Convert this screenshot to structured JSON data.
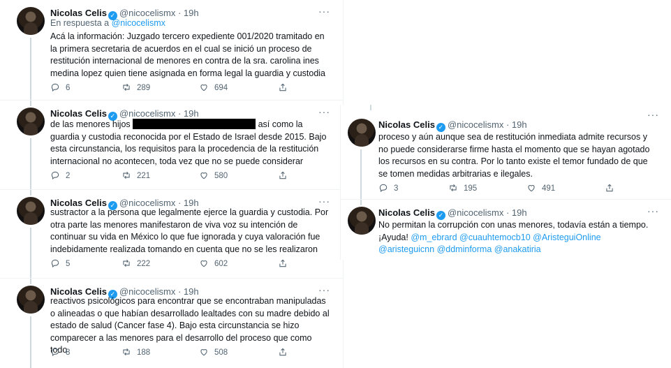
{
  "author": {
    "name": "Nicolas Celis",
    "handle": "@nicocelismx",
    "time": "19h",
    "dot": "·"
  },
  "left_tweets": [
    {
      "reply_prefix": "En respuesta a ",
      "reply_mention": "@nicocelismx",
      "text": "Acá la información: Juzgado tercero expediente 001/2020 tramitado en la primera secretaria de acuerdos en el cual se inició un proceso de restitución internacional de menores en contra de la sra. carolina ines medina lopez quien tiene asignada en forma legal la guardia y custodia",
      "replies": "6",
      "retweets": "289",
      "likes": "694"
    },
    {
      "text_before": "de las menores hijos ",
      "text_after": " así como la guardia y custodia reconocida por el Estado de Israel desde 2015. Bajo esta circunstancia, los requisitos para la procedencia de la restitución internacional no acontecen, toda vez que no se puede considerar",
      "replies": "2",
      "retweets": "221",
      "likes": "580"
    },
    {
      "text": "sustractor a la persona que legalmente ejerce la guardia y custodia. Por otra parte las menores manifestaron de viva voz su intención de continuar su vida en México lo que fue ignorada y cuya  valoración fue indebidamente realizada tomando en cuenta que no se les realizaron",
      "replies": "5",
      "retweets": "222",
      "likes": "602"
    },
    {
      "text": "reactivos  psicológicos para encontrar que se encontraban manipuladas o alineadas o que habían desarrollado lealtades con su madre debido al estado de salud (Cancer fase 4). Bajo esta circunstancia se hizo comparecer a las menores para el desarrollo del proceso que como todo",
      "replies": "8",
      "retweets": "188",
      "likes": "508"
    }
  ],
  "right_tweets": [
    {
      "text": "proceso y aún aunque sea de restitución inmediata admite recursos y no puede considerarse firme hasta el momento que se hayan agotado los recursos en su contra. Por lo tanto existe el temor fundado de que se tomen medidas arbitrarias e ilegales.",
      "replies": "3",
      "retweets": "195",
      "likes": "491"
    },
    {
      "text_line1": "No permitan la corrupción con unas menores, todavía están a tiempo.",
      "text_line2_prefix": "¡Ayuda!  ",
      "mentions": [
        "@m_ebrard",
        "@cuauhtemocb10",
        "@AristeguiOnline",
        "@aristeguicnn",
        "@ddminforma",
        "@anakatiria"
      ]
    }
  ],
  "more_label": "···",
  "colors": {
    "accent": "#1d9bf0",
    "text": "#0f1419",
    "muted": "#536471",
    "divider": "#eff3f4"
  }
}
